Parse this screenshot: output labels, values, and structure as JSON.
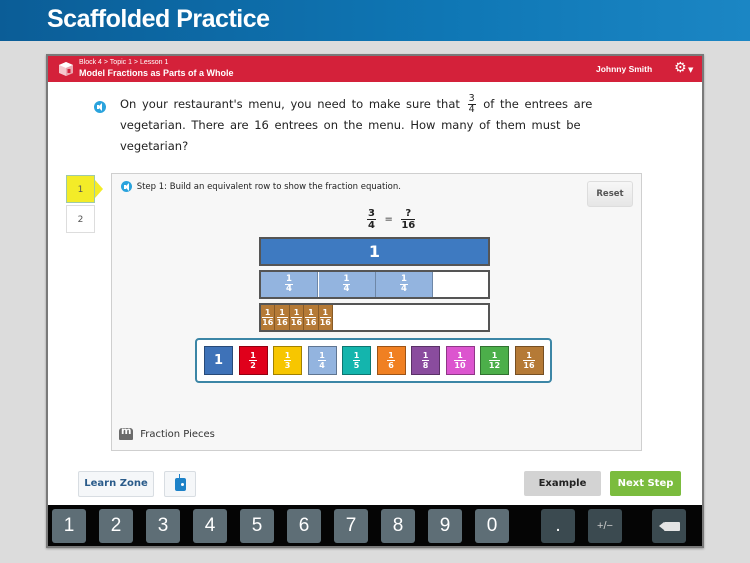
{
  "banner": {
    "title": "Scaffolded Practice"
  },
  "header": {
    "breadcrumb": "Block 4 > Topic 1 > Lesson 1",
    "lesson_title": "Model Fractions as Parts of a Whole",
    "user_name": "Johnny Smith",
    "settings_icon": "gear-icon"
  },
  "question": {
    "before_fraction": "On your restaurant's menu, you need to make sure that",
    "fraction": {
      "num": "3",
      "den": "4"
    },
    "after_fraction": "of the entrees are vegetarian. There are 16 entrees on the menu. How many of them must be vegetarian?"
  },
  "steps": [
    {
      "label": "1",
      "active": true
    },
    {
      "label": "2",
      "active": false
    }
  ],
  "workspace": {
    "instruction": "Step 1: Build an equivalent row to show the fraction equation.",
    "reset_label": "Reset",
    "equation": {
      "left_num": "3",
      "left_den": "4",
      "equals": "=",
      "right_num": "?",
      "right_den": "16"
    },
    "whole_bar_label": "1",
    "quarters_row": {
      "num": "1",
      "den": "4",
      "count": 3
    },
    "sixteenths_row": {
      "num": "1",
      "den": "16",
      "count": 5
    },
    "tray_tiles": [
      {
        "label": "1",
        "color": "#3e72b8"
      },
      {
        "num": "1",
        "den": "2",
        "color": "#e0001b"
      },
      {
        "num": "1",
        "den": "3",
        "color": "#f7c600"
      },
      {
        "num": "1",
        "den": "4",
        "color": "#93b4df"
      },
      {
        "num": "1",
        "den": "5",
        "color": "#14b5ad"
      },
      {
        "num": "1",
        "den": "6",
        "color": "#f08022"
      },
      {
        "num": "1",
        "den": "8",
        "color": "#8a4c9e"
      },
      {
        "num": "1",
        "den": "10",
        "color": "#dc55cf"
      },
      {
        "num": "1",
        "den": "12",
        "color": "#4caf4a"
      },
      {
        "num": "1",
        "den": "16",
        "color": "#b57a36"
      }
    ],
    "fraction_pieces_label": "Fraction Pieces"
  },
  "footer": {
    "learn_zone_label": "Learn Zone",
    "example_label": "Example",
    "next_step_label": "Next Step"
  },
  "keypad": {
    "digits": [
      "1",
      "2",
      "3",
      "4",
      "5",
      "6",
      "7",
      "8",
      "9",
      "0"
    ],
    "decimal": ".",
    "plus_minus": "+/−",
    "backspace_icon": "backspace-icon"
  },
  "colors": {
    "banner_blue": "#0f6fae",
    "header_red": "#d4213a",
    "step_active": "#f3ec28",
    "next_green": "#7bbc3e"
  }
}
